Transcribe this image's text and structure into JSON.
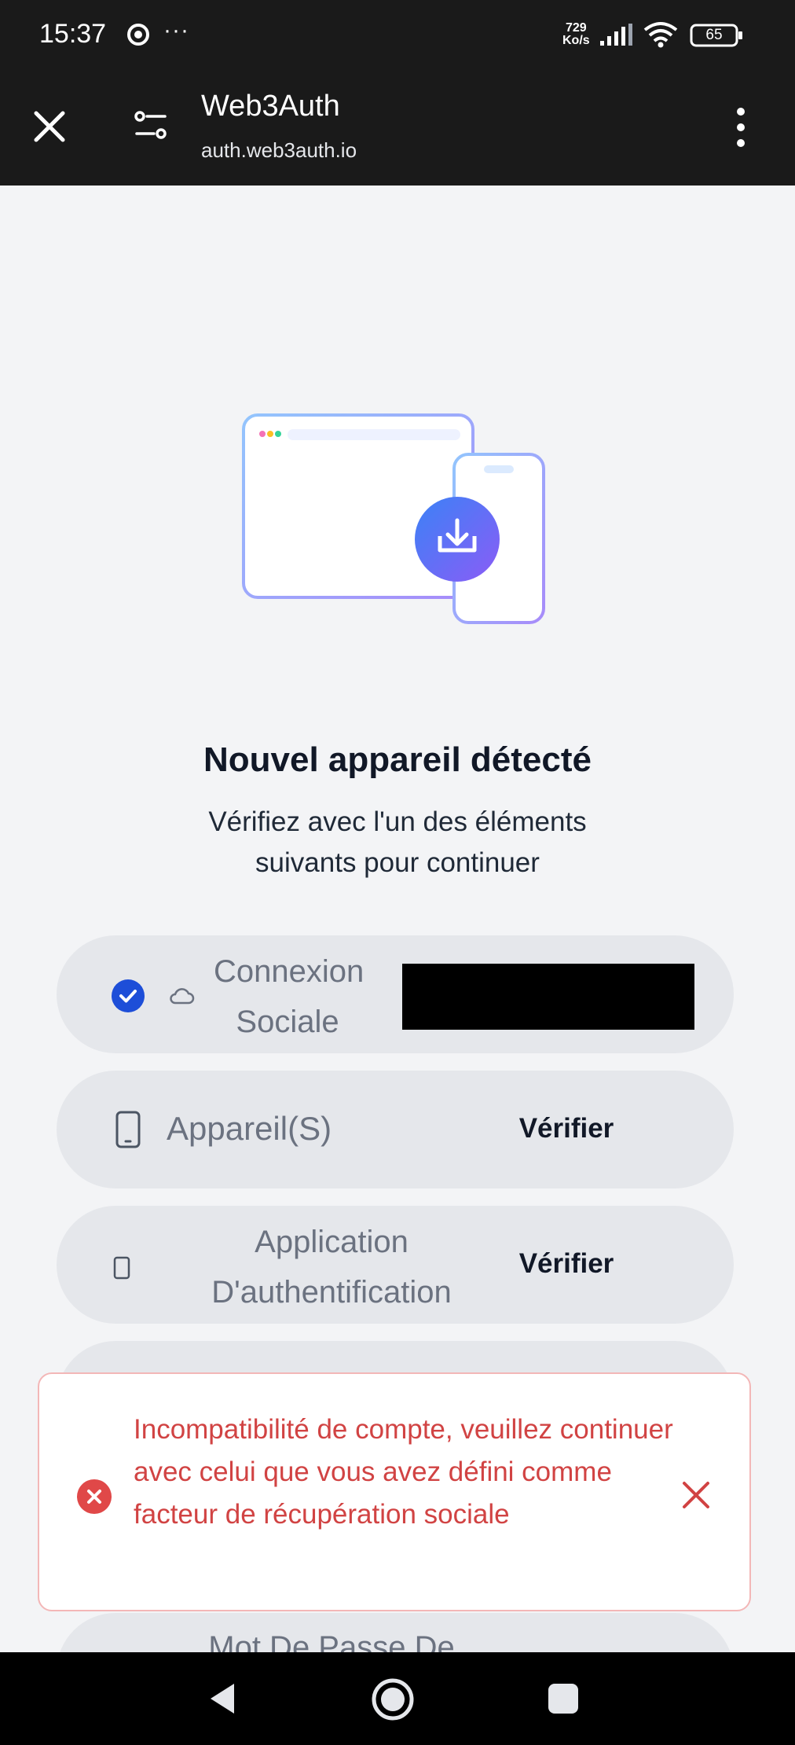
{
  "status_bar": {
    "time": "15:37",
    "more": "···",
    "speed_value": "729",
    "speed_unit": "Ko/s",
    "battery": "65"
  },
  "browser": {
    "title": "Web3Auth",
    "url": "auth.web3auth.io"
  },
  "page": {
    "title": "Nouvel appareil détecté",
    "subtitle": "Vérifiez avec l'un des éléments suivants pour continuer"
  },
  "options": {
    "social": {
      "label_line1": "Connexion",
      "label_line2": "Sociale"
    },
    "device": {
      "label": "Appareil(S)",
      "action": "Vérifier"
    },
    "authenticator": {
      "label_line1": "Application",
      "label_line2": "D'authentification",
      "action": "Vérifier"
    },
    "password": {
      "label_line1": "Mot De Passe De"
    }
  },
  "toast": {
    "message": "Incompatibilité de compte, veuillez continuer avec celui que vous avez défini comme facteur de récupération sociale"
  },
  "colors": {
    "accent": "#1d4ed8",
    "error": "#d14343",
    "chrome_bar": "#1a1a1a"
  }
}
